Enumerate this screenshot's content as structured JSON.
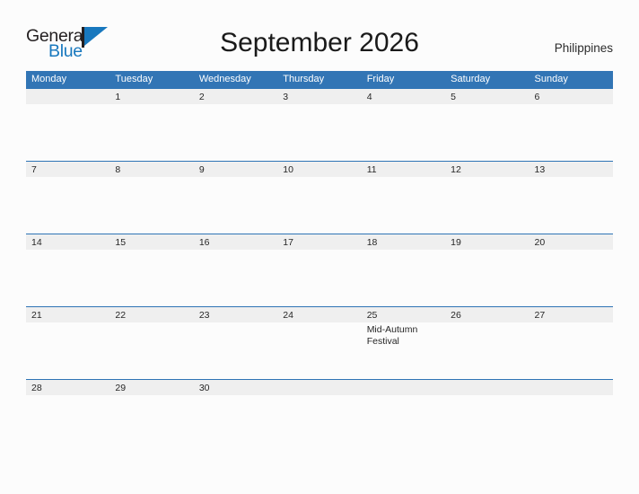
{
  "brand": {
    "name_top": "General",
    "name_bottom": "Blue",
    "flag_icon": "flag-triangle-icon",
    "color_dark": "#231f20",
    "color_blue": "#1878be"
  },
  "header": {
    "title": "September 2026",
    "country": "Philippines"
  },
  "theme": {
    "header_blue": "#3275b5",
    "rule_blue": "#2e74b5",
    "strip_gray": "#efefef",
    "page_background": "#fcfcfc",
    "text": "#262626"
  },
  "weekday_headers": [
    "Monday",
    "Tuesday",
    "Wednesday",
    "Thursday",
    "Friday",
    "Saturday",
    "Sunday"
  ],
  "weeks": [
    [
      {
        "day": "",
        "events": []
      },
      {
        "day": "1",
        "events": []
      },
      {
        "day": "2",
        "events": []
      },
      {
        "day": "3",
        "events": []
      },
      {
        "day": "4",
        "events": []
      },
      {
        "day": "5",
        "events": []
      },
      {
        "day": "6",
        "events": []
      }
    ],
    [
      {
        "day": "7",
        "events": []
      },
      {
        "day": "8",
        "events": []
      },
      {
        "day": "9",
        "events": []
      },
      {
        "day": "10",
        "events": []
      },
      {
        "day": "11",
        "events": []
      },
      {
        "day": "12",
        "events": []
      },
      {
        "day": "13",
        "events": []
      }
    ],
    [
      {
        "day": "14",
        "events": []
      },
      {
        "day": "15",
        "events": []
      },
      {
        "day": "16",
        "events": []
      },
      {
        "day": "17",
        "events": []
      },
      {
        "day": "18",
        "events": []
      },
      {
        "day": "19",
        "events": []
      },
      {
        "day": "20",
        "events": []
      }
    ],
    [
      {
        "day": "21",
        "events": []
      },
      {
        "day": "22",
        "events": []
      },
      {
        "day": "23",
        "events": []
      },
      {
        "day": "24",
        "events": []
      },
      {
        "day": "25",
        "events": [
          "Mid-Autumn Festival"
        ]
      },
      {
        "day": "26",
        "events": []
      },
      {
        "day": "27",
        "events": []
      }
    ],
    [
      {
        "day": "28",
        "events": []
      },
      {
        "day": "29",
        "events": []
      },
      {
        "day": "30",
        "events": []
      },
      {
        "day": "",
        "events": []
      },
      {
        "day": "",
        "events": []
      },
      {
        "day": "",
        "events": []
      },
      {
        "day": "",
        "events": []
      }
    ]
  ]
}
